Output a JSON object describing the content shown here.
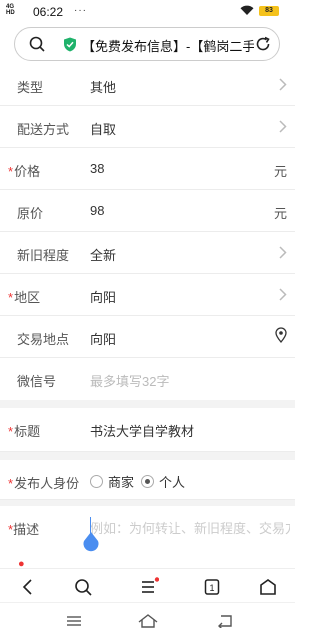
{
  "status_bar": {
    "network": "4G",
    "network_sub": "HD",
    "time": "06:22",
    "dots": "···",
    "battery": "83"
  },
  "address_bar": {
    "url_text": "【免费发布信息】-【鹤岗二手"
  },
  "form": {
    "type": {
      "label": "类型",
      "value": "其他"
    },
    "delivery": {
      "label": "配送方式",
      "value": "自取"
    },
    "price": {
      "label": "价格",
      "value": "38",
      "unit": "元"
    },
    "original_price": {
      "label": "原价",
      "value": "98",
      "unit": "元"
    },
    "condition": {
      "label": "新旧程度",
      "value": "全新"
    },
    "region": {
      "label": "地区",
      "value": "向阳"
    },
    "location": {
      "label": "交易地点",
      "value": "向阳"
    },
    "wechat": {
      "label": "微信号",
      "placeholder": "最多填写32字"
    },
    "title": {
      "label": "标题",
      "value": "书法大学自学教材"
    },
    "identity": {
      "label": "发布人身份",
      "options": [
        "商家",
        "个人"
      ],
      "selected": "个人"
    },
    "description": {
      "label": "描述",
      "placeholder": "例如：为何转让、新旧程度、交易方式"
    },
    "required_mark": "*"
  },
  "colors": {
    "required": "#e33333",
    "battery": "#f5c21b",
    "shield": "#1fb26b",
    "cursor": "#4a8df0"
  }
}
